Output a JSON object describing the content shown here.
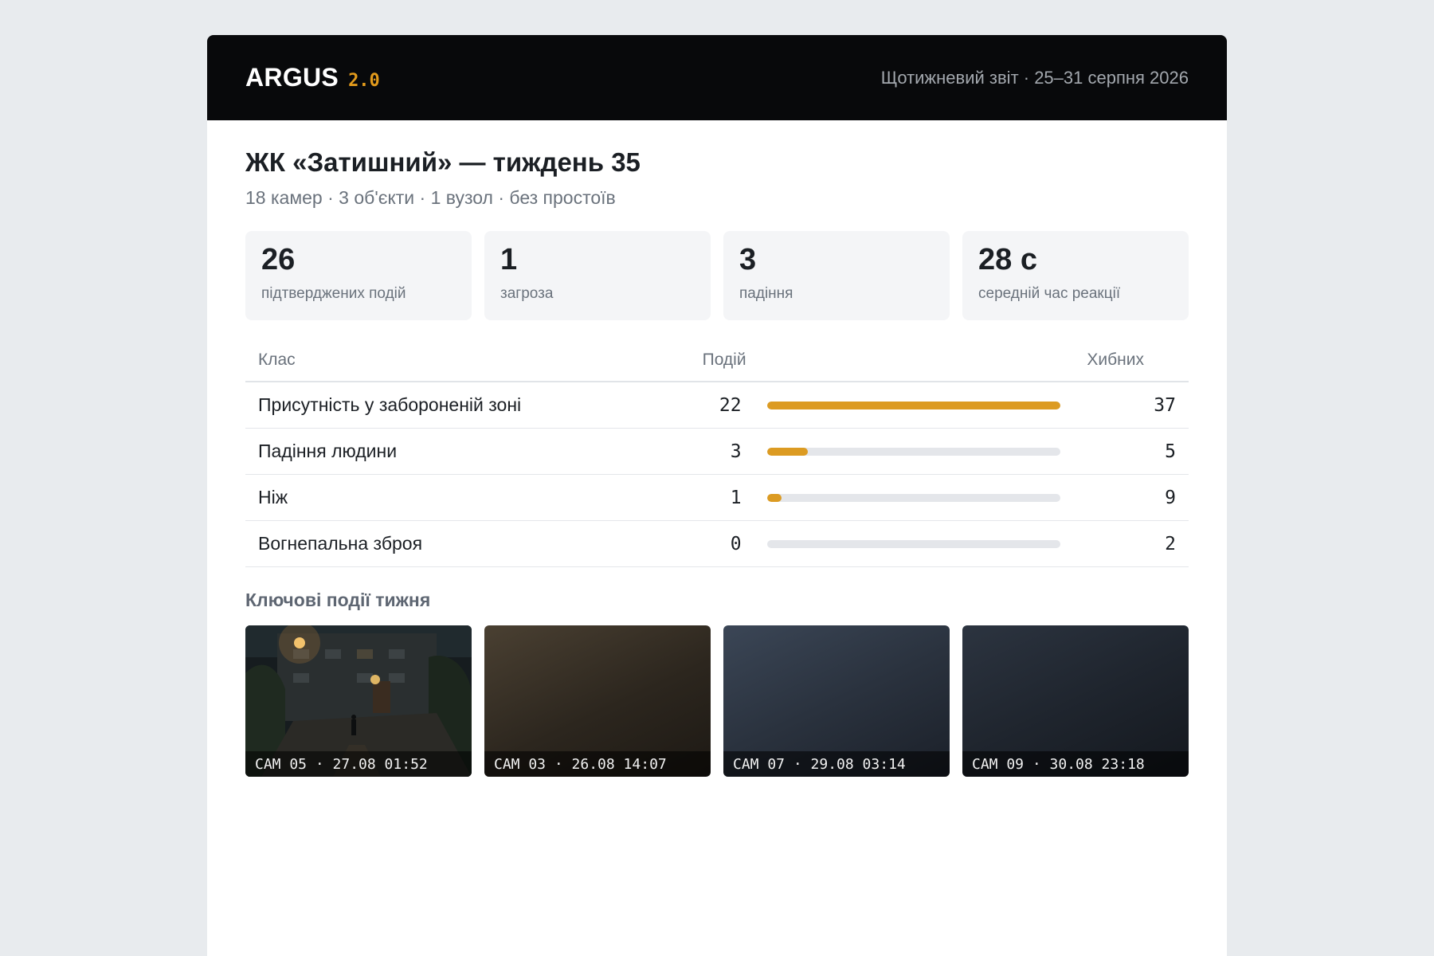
{
  "header": {
    "brand": "ARGUS",
    "version": "2.0",
    "report_period": "Щотижневий звіт · 25–31 серпня 2026"
  },
  "page": {
    "title": "ЖК «Затишний» — тиждень 35",
    "subtitle": "18 камер · 3 об'єкти · 1 вузол · без простоїв"
  },
  "kpis": [
    {
      "value": "26",
      "label": "підтверджених подій"
    },
    {
      "value": "1",
      "label": "загроза"
    },
    {
      "value": "3",
      "label": "падіння"
    },
    {
      "value": "28 с",
      "label": "середній час реакції"
    }
  ],
  "table": {
    "columns": {
      "class": "Клас",
      "events": "Подій",
      "false": "Хибних"
    },
    "rows": [
      {
        "name": "Присутність у забороненій зоні",
        "events": "22",
        "bar_fraction": 1.0,
        "false": "37"
      },
      {
        "name": "Падіння людини",
        "events": "3",
        "bar_fraction": 0.14,
        "false": "5"
      },
      {
        "name": "Ніж",
        "events": "1",
        "bar_fraction": 0.05,
        "false": "9"
      },
      {
        "name": "Вогнепальна зброя",
        "events": "0",
        "bar_fraction": 0,
        "false": "2"
      }
    ]
  },
  "highlights": {
    "title": "Ключові події тижня",
    "items": [
      {
        "caption": "CAM 05 · 27.08 01:52"
      },
      {
        "caption": "CAM 03 · 26.08 14:07"
      },
      {
        "caption": "CAM 07 · 29.08 03:14"
      },
      {
        "caption": "CAM 09 · 30.08 23:18"
      }
    ]
  },
  "colors": {
    "accent": "#e39b1c",
    "bar": "#dc9b22",
    "topbar": "#08090b"
  }
}
